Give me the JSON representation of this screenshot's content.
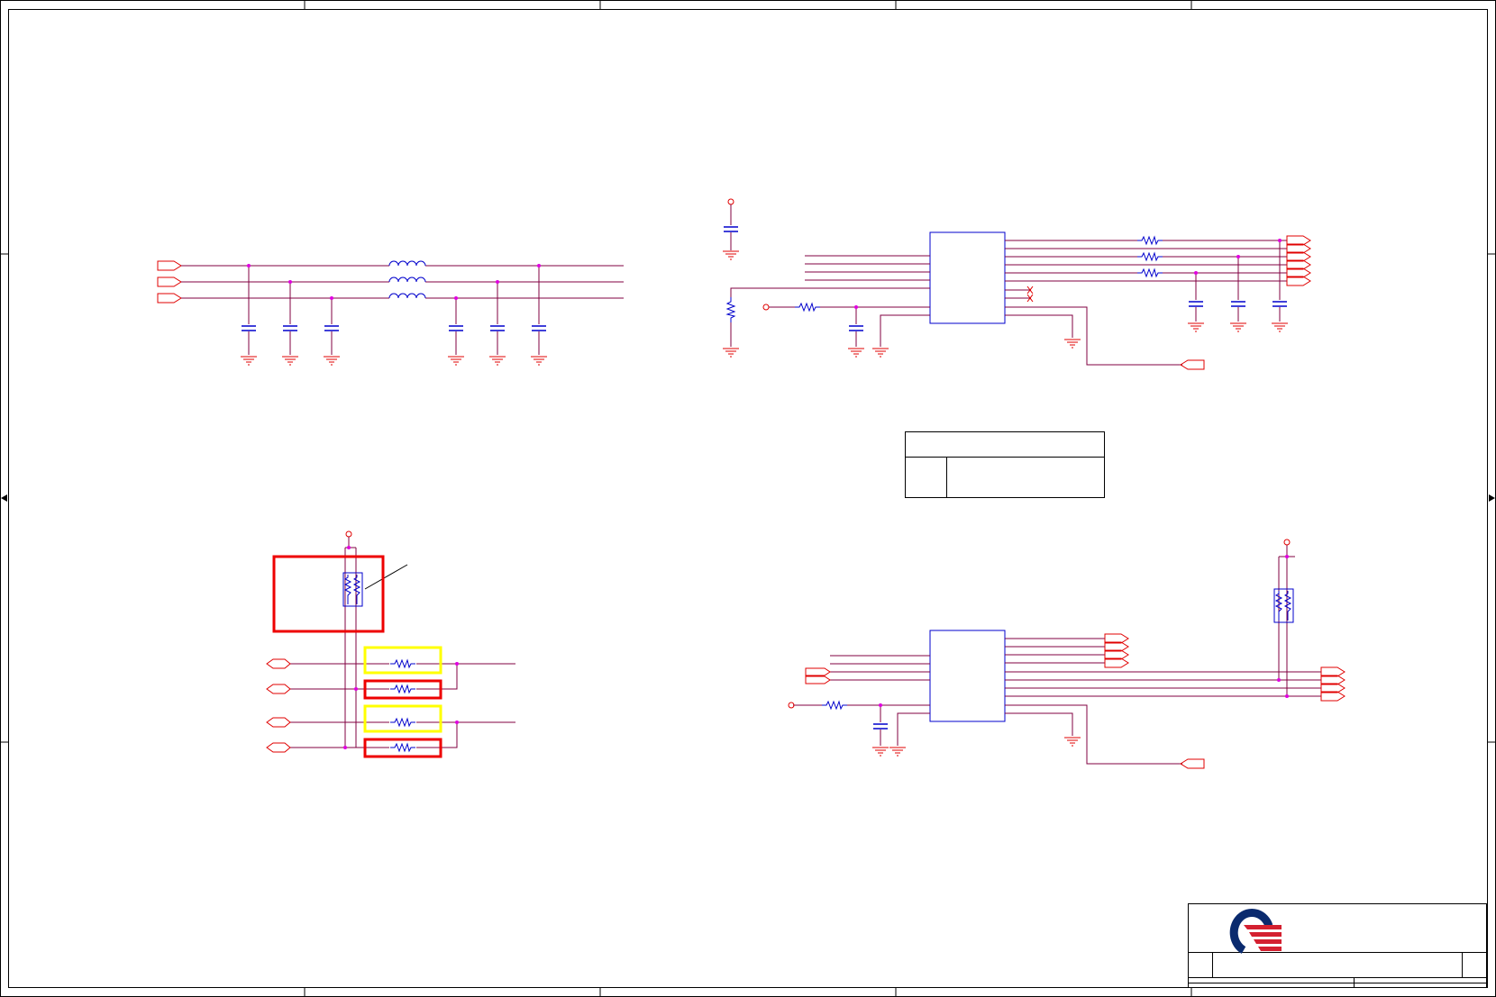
{
  "sheet": {
    "colors": {
      "frame": "#000000",
      "wire": "#800040",
      "pin": "#e00000",
      "part": "#0000cc",
      "junction": "#e000e0",
      "highlight_red": "#ee0000",
      "highlight_yellow": "#ffff00",
      "logo_blue": "#0a2a6e",
      "logo_red": "#d42030"
    },
    "icons": {
      "ground": "ground-icon",
      "power": "power-rail-icon",
      "offpage": "off-page-connector-icon",
      "logo": "company-logo-icon"
    }
  }
}
